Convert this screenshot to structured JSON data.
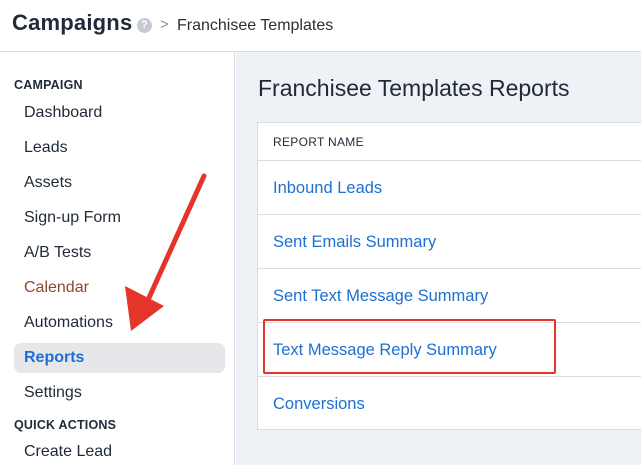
{
  "header": {
    "app_title": "Campaigns",
    "help_icon": "?",
    "breadcrumb_separator": ">",
    "breadcrumb_current": "Franchisee Templates"
  },
  "sidebar": {
    "campaign_section_label": "CAMPAIGN",
    "items": [
      {
        "label": "Dashboard",
        "active": false
      },
      {
        "label": "Leads",
        "active": false
      },
      {
        "label": "Assets",
        "active": false
      },
      {
        "label": "Sign-up Form",
        "active": false
      },
      {
        "label": "A/B Tests",
        "active": false
      },
      {
        "label": "Calendar",
        "active": false
      },
      {
        "label": "Automations",
        "active": false
      },
      {
        "label": "Reports",
        "active": true
      },
      {
        "label": "Settings",
        "active": false
      }
    ],
    "quick_actions_label": "QUICK ACTIONS",
    "quick_actions": [
      {
        "label": "Create Lead"
      }
    ]
  },
  "main": {
    "title": "Franchisee Templates Reports",
    "table": {
      "column_header": "REPORT NAME",
      "rows": [
        "Inbound Leads",
        "Sent Emails Summary",
        "Sent Text Message Summary",
        "Text Message Reply Summary",
        "Conversions"
      ]
    }
  },
  "annotations": {
    "highlighted_row": "Text Message Reply Summary",
    "pointed_item": "Reports",
    "annotation_color": "#e5352b"
  },
  "colors": {
    "link": "#1d6fd1",
    "active_bg": "#e5e7eb",
    "main_bg": "#eef1f6"
  }
}
